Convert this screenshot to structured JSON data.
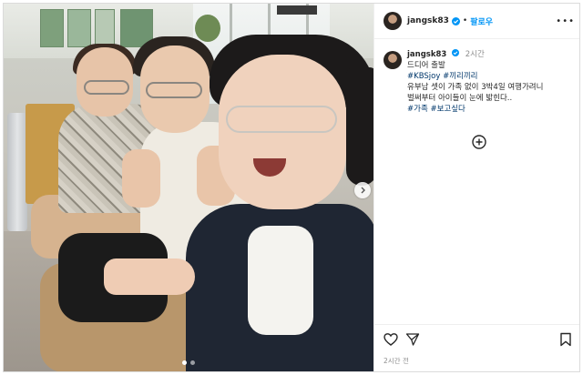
{
  "post": {
    "username": "jangsk83",
    "follow_label": "팔로우",
    "header_separator": "•",
    "caption_time": "2시간",
    "caption_lines": [
      "드디어 출발",
      "유부남 셋이 가족 없이 3박4일 여행가려니",
      "벌써부터 아이들이 눈에 밟힌다.."
    ],
    "hashtags_line1": [
      "#KBSjoy",
      "#끼리끼리"
    ],
    "hashtags_line2": [
      "#가족",
      "#보고싶다"
    ],
    "posted_ago": "2시간 전"
  },
  "icons": {
    "verified": "verified-badge-icon",
    "more": "more-options-icon",
    "add": "add-comment-icon",
    "like": "heart-icon",
    "share": "share-icon",
    "save": "bookmark-icon",
    "next": "chevron-right-icon"
  },
  "carousel": {
    "slide_count": 2,
    "active_index": 0
  },
  "colors": {
    "link": "#00376b",
    "follow": "#0095f6",
    "verified": "#0095f6",
    "muted": "#8e8e8e"
  }
}
